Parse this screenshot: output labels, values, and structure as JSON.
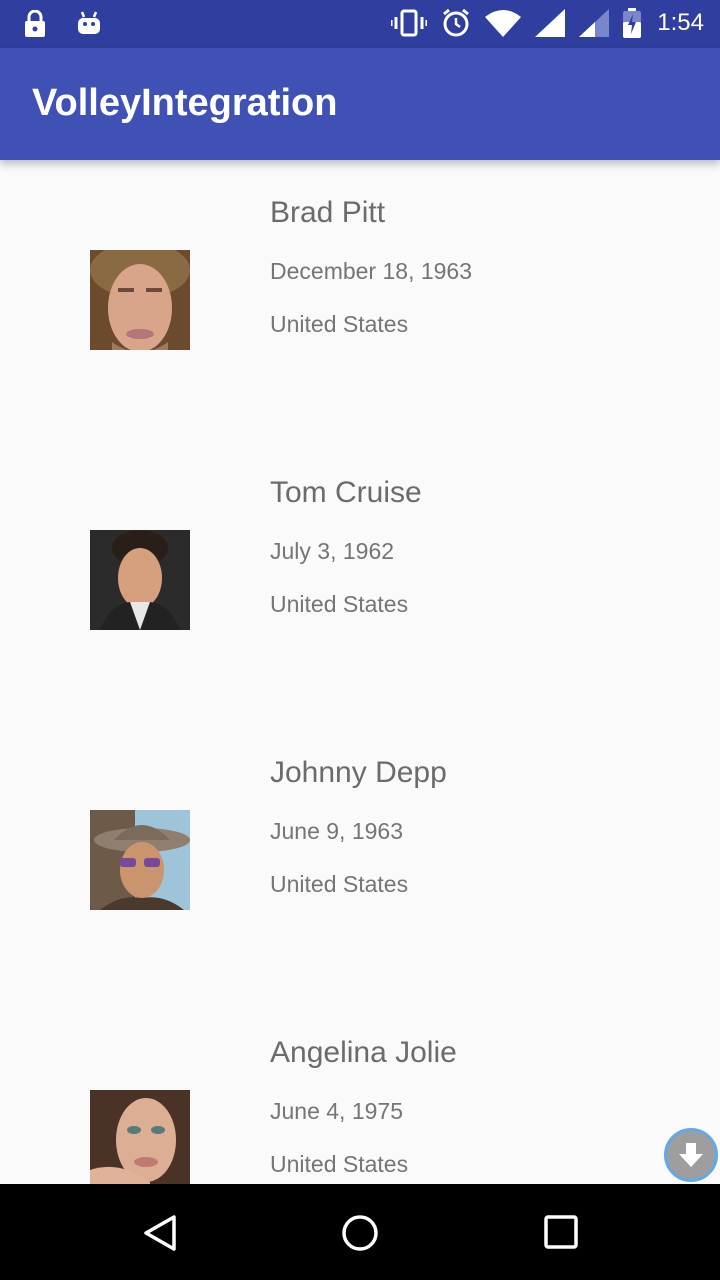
{
  "status_bar": {
    "time": "1:54",
    "icons": [
      "lock-icon",
      "android-icon",
      "vibrate-icon",
      "alarm-icon",
      "wifi-icon",
      "signal-icon",
      "signal-weak-icon",
      "battery-icon"
    ]
  },
  "app_bar": {
    "title": "VolleyIntegration"
  },
  "people": [
    {
      "name": "Brad Pitt",
      "dob": "December 18, 1963",
      "country": "United States"
    },
    {
      "name": "Tom Cruise",
      "dob": "July 3, 1962",
      "country": "United States"
    },
    {
      "name": "Johnny Depp",
      "dob": "June 9, 1963",
      "country": "United States"
    },
    {
      "name": "Angelina Jolie",
      "dob": "June 4, 1975",
      "country": "United States"
    }
  ],
  "nav_bar": {
    "icons": [
      "back-icon",
      "home-icon",
      "recents-icon"
    ]
  },
  "colors": {
    "primary": "#3f51b5",
    "primary_dark": "#303f9f",
    "text_secondary": "#757575"
  }
}
